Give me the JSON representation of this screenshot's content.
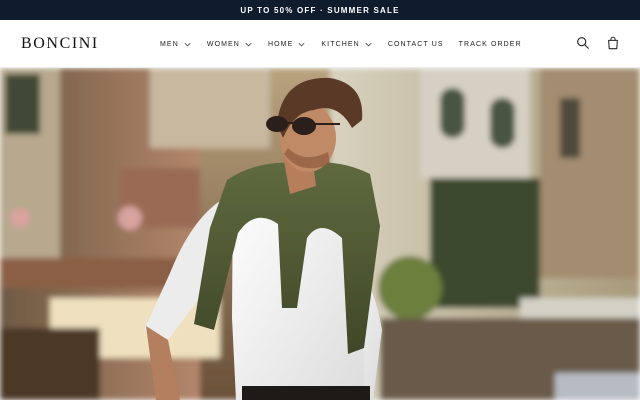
{
  "announcement": "UP TO 50% OFF · SUMMER SALE",
  "brand": "BONCINI",
  "nav": [
    {
      "label": "MEN",
      "dropdown": true
    },
    {
      "label": "WOMEN",
      "dropdown": true
    },
    {
      "label": "HOME",
      "dropdown": true
    },
    {
      "label": "KITCHEN",
      "dropdown": true
    },
    {
      "label": "CONTACT US",
      "dropdown": false
    },
    {
      "label": "TRACK ORDER",
      "dropdown": false
    }
  ],
  "icons": {
    "search": "search-icon",
    "cart": "shopping-bag-icon"
  },
  "colors": {
    "announcement_bg": "#0f1c2e",
    "text": "#111111"
  }
}
